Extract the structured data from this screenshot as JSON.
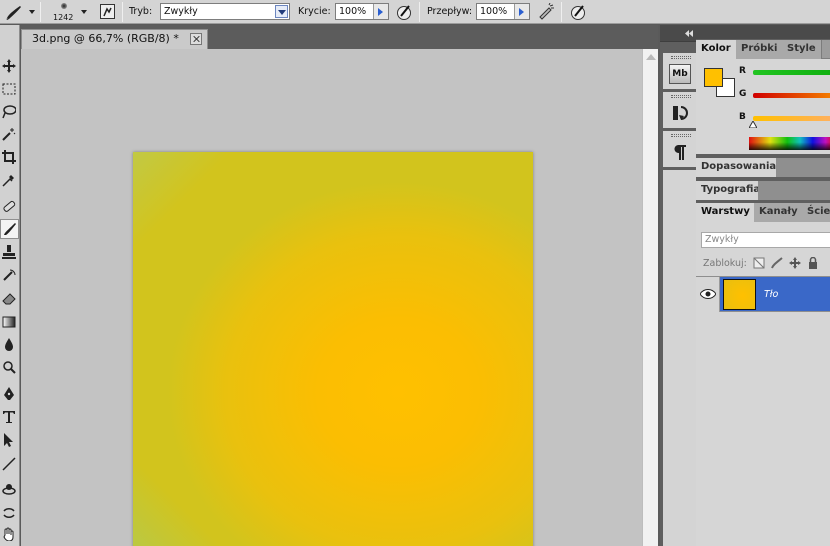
{
  "options_bar": {
    "brush_size": "1242",
    "mode_label": "Tryb:",
    "mode_value": "Zwykły",
    "opacity_label": "Krycie:",
    "opacity_value": "100%",
    "flow_label": "Przepływ:",
    "flow_value": "100%"
  },
  "document": {
    "tab_title": "3d.png @ 66,7% (RGB/8) *"
  },
  "color_panel": {
    "tabs": [
      "Kolor",
      "Próbki",
      "Style"
    ],
    "channels": [
      "R",
      "G",
      "B"
    ],
    "foreground_color": "#ffc000",
    "background_color": "#ffffff"
  },
  "adjustments_panel": {
    "tab": "Dopasowania"
  },
  "typography_panel": {
    "tab": "Typografia"
  },
  "layers_panel": {
    "tabs": [
      "Warstwy",
      "Kanały",
      "Ście"
    ],
    "blend_mode": "Zwykły",
    "lock_label": "Zablokuj:",
    "layers": [
      {
        "name": "Tło"
      }
    ]
  },
  "dock": {
    "mini_bridge_label": "Mb"
  }
}
